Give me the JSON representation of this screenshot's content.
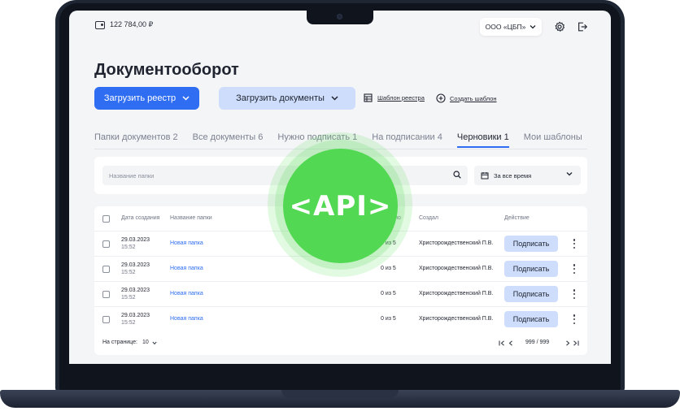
{
  "header": {
    "balance": "122 784,00 ₽",
    "org_name": "ООО «ЦБП»"
  },
  "page": {
    "title": "Документооборот"
  },
  "toolbar": {
    "upload_registry": "Загрузить реестр",
    "upload_documents": "Загрузить документы",
    "registry_template": "Шаблон реестра",
    "create_template": "Создать шаблон"
  },
  "tabs": [
    {
      "label": "Папки документов 2"
    },
    {
      "label": "Все документы 6"
    },
    {
      "label": "Нужно подписать 1"
    },
    {
      "label": "На подписании 4"
    },
    {
      "label": "Черновики 1",
      "active": true
    },
    {
      "label": "Мои шаблоны"
    }
  ],
  "filters": {
    "search_placeholder": "Название папки",
    "period": "За все время"
  },
  "table": {
    "columns": {
      "created": "Дата создания",
      "folder": "Название папки",
      "signed": "...исано",
      "creator": "Создал",
      "action": "Действие"
    },
    "rows": [
      {
        "date": "29.03.2023",
        "time": "15:52",
        "folder": "Новая папка",
        "signed": "0 из 5",
        "creator": "Христорождественский П.В.",
        "action": "Подписать"
      },
      {
        "date": "29.03.2023",
        "time": "15:52",
        "folder": "Новая папка",
        "signed": "0 из 5",
        "creator": "Христорождественский П.В.",
        "action": "Подписать"
      },
      {
        "date": "29.03.2023",
        "time": "15:52",
        "folder": "Новая папка",
        "signed": "0 из 5",
        "creator": "Христорождественский П.В.",
        "action": "Подписать"
      },
      {
        "date": "29.03.2023",
        "time": "15:52",
        "folder": "Новая папка",
        "signed": "0 из 5",
        "creator": "Христорождественский П.В.",
        "action": "Подписать"
      }
    ],
    "per_page_label": "На странице:",
    "per_page_value": "10",
    "page_info": "999 / 999"
  },
  "badge": {
    "text": "<API>"
  },
  "colors": {
    "accent": "#2f6df2",
    "secondary_button": "#cdddfb",
    "badge_green": "#52d852",
    "laptop_body": "#1e2533"
  }
}
